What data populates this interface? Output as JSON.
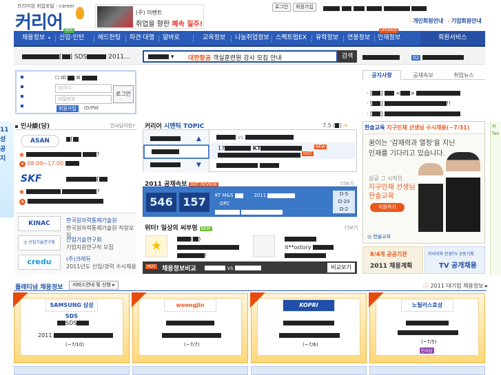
{
  "header": {
    "logo_tag": "프리미엄 취업포털 - career",
    "logo_text": "커리어",
    "promo_line1": "(주) 이벤트",
    "promo_line2a": "취업을 향한 ",
    "promo_line2b": "폐속 질주!",
    "btn_login": "로그인",
    "btn_join": "회원가입",
    "member_personal": "개인회원안내",
    "member_company": "기업회원안내"
  },
  "nav": {
    "items": [
      "채용정보",
      "신입·인턴",
      "헤드헌팅",
      "파견·대행",
      "알바로",
      "교육정보",
      "나눔취업정보",
      "스펙트럼EX",
      "유학정보",
      "연봉정보",
      "인재정보",
      "회원서비스"
    ],
    "badge_new": "NEW",
    "badge_upgrade": "UPGRADE"
  },
  "subbar": {
    "crumb_text": "SDS",
    "crumb_year": "2011",
    "search_highlight": "대한항공",
    "search_rest": " 객실훈련원 강사 모집 안내",
    "search_btn": "검색",
    "hot_num": "02"
  },
  "login": {
    "id_label": "ID",
    "id_placeholder": "아이디",
    "pw_placeholder": "비밀번호",
    "login_btn": "로그인",
    "join_btn": "회원가입",
    "idpw": "ID/PW"
  },
  "tabs": {
    "notice": "공지사항",
    "exam": "공채속보",
    "news": "취업뉴스"
  },
  "interview": {
    "title": "인사談(담)",
    "more": "인사담이란?",
    "company1": "ASAN",
    "time": "08:00~17:00",
    "company2": "SKF",
    "kinac": "KINAC",
    "kinac_line1": "한국원자력통제기술원",
    "kinac_line2": "한국원자력통제기술원 직원모집",
    "kitech_line1": "산업기술연구회",
    "kitech_line2": "기업지원연구직 모집",
    "credu": "credu",
    "credu_line1": "(주)크레듀",
    "credu_line2": "2011년도 신입/경력 수시채용"
  },
  "topic": {
    "title_prefix": "커리어 ",
    "title_main": "시멘틱 TOPIC",
    "date": "7.5",
    "vs": "vs",
    "kt": "KT",
    "new": "NEW",
    "hot": "HOT"
  },
  "gongchae": {
    "title": "2011 공채속보",
    "hot_review": "HOT REVIEW",
    "more": "더보기",
    "n1": "546",
    "n2": "157",
    "kt": "KT M&S",
    "opc": "OPC",
    "year": "2011",
    "d5": "D-5",
    "d20": "D-20",
    "d2": "D-2"
  },
  "witter": {
    "title": "위터! 일상의 씨부렁",
    "new": "NEW",
    "more": "더보기",
    "ostory": "it**ostory"
  },
  "compare": {
    "hot": "HOT",
    "title": "채용정보비교",
    "vs": "vs",
    "btn": "비교보기"
  },
  "ad": {
    "headline_a": "한솔교육 ",
    "headline_b": "지구인재 선생님 수시채용(~7/31)",
    "slogan1": "꿈이는 '감재력과 열정'을 지닌",
    "slogan2": "인재를 기다리고 있습니다.",
    "sub1": "성공 그 시작은",
    "sub2": "지구인재 선생님",
    "sub3": "한솔교육",
    "apply": "지원하기",
    "brand": "한솔교육"
  },
  "banners": {
    "public_a": "8/4개 공공기관",
    "public_b": "2011 채용계획",
    "tv_a": "커리어와 한경TV 공동기획",
    "tv_b": "TV 공개채용"
  },
  "platinum": {
    "title": "플래티넘 채용정보",
    "service_btn": "서비스안내 및 신청",
    "bigcorp": "2011 대기업 채용정보",
    "cards": [
      {
        "logo": "SAMSUNG 삼성SDS",
        "sub": "SDS",
        "year": "2011",
        "deadline": "(~7/10)"
      },
      {
        "logo": "woongjin",
        "sub": "",
        "year": "",
        "deadline": "(~7/7)"
      },
      {
        "logo": "KOPRI",
        "sub": "",
        "year": "",
        "deadline": "(~7/6)"
      },
      {
        "logo": "노틸러스효성",
        "sub": "",
        "year": "",
        "deadline": "(~7/5)"
      }
    ],
    "special": "SPECIAL",
    "badge": "인사담"
  },
  "colors": {
    "primary": "#1f4fa8",
    "nav": "#2a5bb8",
    "accent": "#e8581c",
    "gold": "#f5a623"
  }
}
